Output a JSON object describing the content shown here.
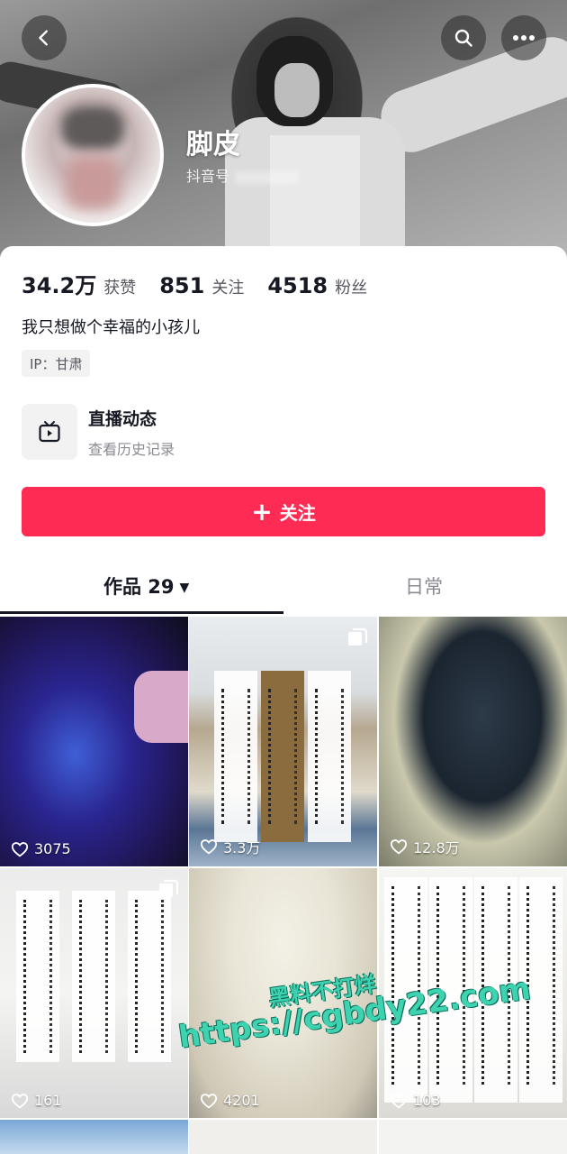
{
  "header": {
    "nickname": "脚皮",
    "douyin_id_label": "抖音号"
  },
  "icons": {
    "back": "chevron-left-icon",
    "search": "search-icon",
    "more": "more-dots-icon",
    "live": "tv-icon",
    "like": "heart-outline-icon",
    "multi": "multi-image-icon"
  },
  "stats": [
    {
      "value": "34.2万",
      "label": "获赞"
    },
    {
      "value": "851",
      "label": "关注"
    },
    {
      "value": "4518",
      "label": "粉丝"
    }
  ],
  "bio": "我只想做个幸福的小孩儿",
  "ip_tag": "IP：甘肃",
  "live": {
    "title": "直播动态",
    "subtitle": "查看历史记录"
  },
  "follow_button": {
    "plus": "+",
    "label": "关注"
  },
  "tabs": {
    "works_label": "作品 29",
    "works_caret": "▼",
    "daily_label": "日常"
  },
  "videos": [
    {
      "likes": "3075",
      "multi": false
    },
    {
      "likes": "3.3万",
      "multi": true
    },
    {
      "likes": "12.8万",
      "multi": false
    },
    {
      "likes": "161",
      "multi": true
    },
    {
      "likes": "4201",
      "multi": false
    },
    {
      "likes": "103",
      "multi": false
    }
  ],
  "watermark": {
    "line1": "黑料不打烊",
    "line2": "https://cgbdy22.com"
  },
  "colors": {
    "accent": "#fe2c55",
    "text_primary": "#161823",
    "text_secondary": "#8a8b91"
  }
}
